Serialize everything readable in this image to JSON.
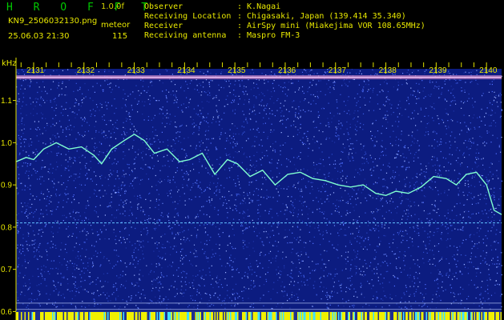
{
  "header": {
    "brand": "H R O F F T",
    "version": "1.0.0f",
    "filename": "KN9_2506032130.png",
    "meteor_label": "meteor",
    "timestamp": "25.06.03 21:30",
    "meteor_count": "115",
    "meta": [
      {
        "key": "Observer",
        "value": ": K.Nagai"
      },
      {
        "key": "Receiving Location",
        "value": ": Chigasaki, Japan (139.414 35.340)"
      },
      {
        "key": "Receiver",
        "value": ": AirSpy mini (Miakejima VOR 108.65MHz)"
      },
      {
        "key": "Receiving antenna",
        "value": ": Maspro FM-3"
      }
    ]
  },
  "colors": {
    "text": "#e8e800",
    "brand": "#00c800",
    "background_noise": "#10208a",
    "trace": "#80ffd0",
    "tick_label": "#e8e800"
  },
  "chart_data": {
    "type": "heatmap",
    "description_units": "spectrogram",
    "ylabel": "kHz",
    "x_tick_labels": [
      "2131",
      "2132",
      "2133",
      "2134",
      "2135",
      "2136",
      "2137",
      "2138",
      "2139",
      "2140"
    ],
    "y_tick_labels": [
      "1.1",
      "1.0",
      "0.9",
      "0.8",
      "0.7",
      "0.6"
    ],
    "y_ticks": [
      1.1,
      1.0,
      0.9,
      0.8,
      0.7,
      0.6
    ],
    "ylim": [
      0.58,
      1.175
    ],
    "xlim": [
      2130.65,
      2140.3
    ],
    "carrier_khz": 1.155,
    "steady_line_khz": 0.81,
    "bottom_lines_khz": [
      0.62,
      0.605
    ],
    "trace": {
      "x": [
        2130.65,
        2130.85,
        2131.0,
        2131.2,
        2131.45,
        2131.7,
        2131.95,
        2132.2,
        2132.35,
        2132.55,
        2132.8,
        2133.0,
        2133.2,
        2133.4,
        2133.65,
        2133.9,
        2134.1,
        2134.35,
        2134.6,
        2134.85,
        2135.05,
        2135.3,
        2135.55,
        2135.8,
        2136.05,
        2136.3,
        2136.55,
        2136.8,
        2137.05,
        2137.3,
        2137.55,
        2137.8,
        2138.0,
        2138.2,
        2138.45,
        2138.7,
        2138.95,
        2139.2,
        2139.4,
        2139.6,
        2139.8,
        2140.0,
        2140.15,
        2140.3
      ],
      "y": [
        0.955,
        0.965,
        0.96,
        0.985,
        1.0,
        0.985,
        0.99,
        0.97,
        0.95,
        0.985,
        1.005,
        1.02,
        1.005,
        0.975,
        0.985,
        0.955,
        0.96,
        0.975,
        0.925,
        0.96,
        0.95,
        0.92,
        0.935,
        0.9,
        0.925,
        0.93,
        0.915,
        0.91,
        0.9,
        0.895,
        0.9,
        0.88,
        0.875,
        0.885,
        0.88,
        0.895,
        0.92,
        0.915,
        0.9,
        0.925,
        0.93,
        0.9,
        0.84,
        0.83
      ]
    }
  }
}
